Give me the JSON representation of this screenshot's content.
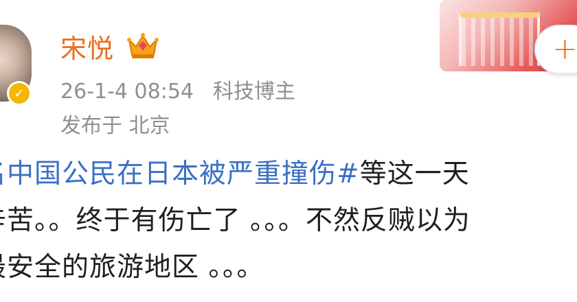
{
  "post": {
    "author": {
      "name": "宋悦",
      "crown_icon": "crown-icon",
      "verified_icon": "verified-v-icon"
    },
    "timestamp": "26-1-4 08:54",
    "author_tag": "科技博主",
    "location": "发布于 北京",
    "follow_label": "+",
    "content": {
      "line1_hashtag": "名中国公民在日本被严重撞伤#",
      "line1_text": "等这一天",
      "line2": "辛苦。。终于有伤亡了 。。。不然反贼以为",
      "line3": "最安全的旅游地区 。。。"
    }
  },
  "colors": {
    "username": "#ea6f1e",
    "meta": "#8f8f8f",
    "hashtag": "#3b6fc4",
    "badge": "#f5b800"
  }
}
